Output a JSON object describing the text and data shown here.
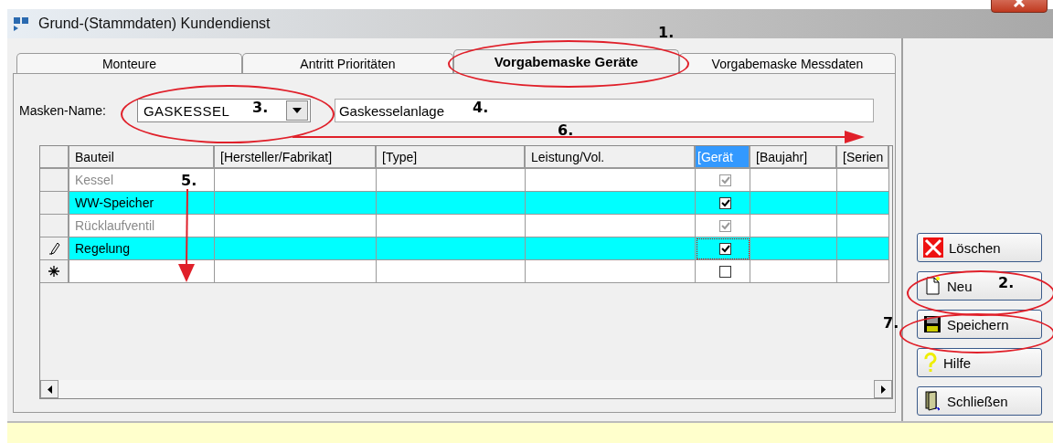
{
  "window": {
    "title": "Grund-(Stammdaten) Kundendienst"
  },
  "tabs": [
    {
      "label": "Monteure",
      "selected": false
    },
    {
      "label": "Antritt Prioritäten",
      "selected": false
    },
    {
      "label": "Vorgabemaske Geräte",
      "selected": true
    },
    {
      "label": "Vorgabemaske Messdaten",
      "selected": false
    }
  ],
  "mask": {
    "label": "Masken-Name:",
    "value": "GASKESSEL",
    "description": "Gaskesselanlage"
  },
  "table": {
    "columns": [
      {
        "label": "Bauteil",
        "selected": false
      },
      {
        "label": "[Hersteller/Fabrikat]",
        "selected": false
      },
      {
        "label": "[Type]",
        "selected": false
      },
      {
        "label": "Leistung/Vol.",
        "selected": false
      },
      {
        "label": "[Gerät",
        "selected": true
      },
      {
        "label": "[Baujahr]",
        "selected": false
      },
      {
        "label": "[Serien",
        "selected": false
      }
    ],
    "rows": [
      {
        "editing": false,
        "new_row": false,
        "bauteil": "Kessel",
        "highlighted": false,
        "dimmed": true,
        "checked": true,
        "focused": false
      },
      {
        "editing": false,
        "new_row": false,
        "bauteil": "WW-Speicher",
        "highlighted": true,
        "dimmed": false,
        "checked": true,
        "focused": false
      },
      {
        "editing": false,
        "new_row": false,
        "bauteil": "Rücklaufventil",
        "highlighted": false,
        "dimmed": true,
        "checked": true,
        "focused": false
      },
      {
        "editing": true,
        "new_row": false,
        "bauteil": "Regelung",
        "highlighted": true,
        "dimmed": false,
        "checked": true,
        "focused": true
      },
      {
        "editing": false,
        "new_row": true,
        "bauteil": "",
        "highlighted": false,
        "dimmed": false,
        "checked": false,
        "focused": false
      }
    ]
  },
  "buttons": [
    {
      "kind": "delete",
      "label": "Löschen"
    },
    {
      "kind": "new",
      "label": "Neu"
    },
    {
      "kind": "save",
      "label": "Speichern"
    },
    {
      "kind": "help",
      "label": "Hilfe"
    },
    {
      "kind": "close",
      "label": "Schließen"
    }
  ],
  "annotations": [
    "1.",
    "2.",
    "3.",
    "4.",
    "5.",
    "6.",
    "7."
  ]
}
